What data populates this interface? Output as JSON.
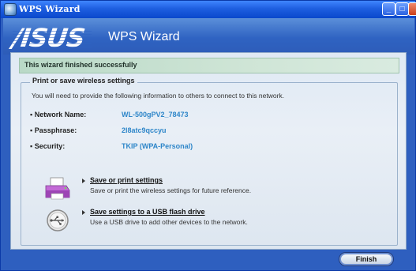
{
  "window": {
    "title": "WPS Wizard"
  },
  "header": {
    "logo": "/ISUS",
    "title": "WPS Wizard"
  },
  "banner": {
    "text": "This wizard finished successfully"
  },
  "section": {
    "legend": "Print or save wireless settings",
    "intro": "You will need to provide the following information to others to connect to this network."
  },
  "network": {
    "rows": [
      {
        "label": "▪ Network Name:",
        "value": "WL-500gPV2_78473"
      },
      {
        "label": "▪ Passphrase:",
        "value": "2l8atc9qccyu"
      },
      {
        "label": "▪ Security:",
        "value": "TKIP (WPA-Personal)"
      }
    ]
  },
  "actions": [
    {
      "icon": "printer-icon",
      "link": "Save or print settings",
      "desc": "Save or print the wireless settings for future reference."
    },
    {
      "icon": "usb-icon",
      "link": "Save settings to a USB flash drive",
      "desc": "Use a USB drive to add other devices to the network."
    }
  ],
  "footer": {
    "finish_label": "Finish"
  },
  "colors": {
    "accent": "#2e86c9",
    "title_bar": "#1e5fe0",
    "banner": "#cfe5d6"
  }
}
